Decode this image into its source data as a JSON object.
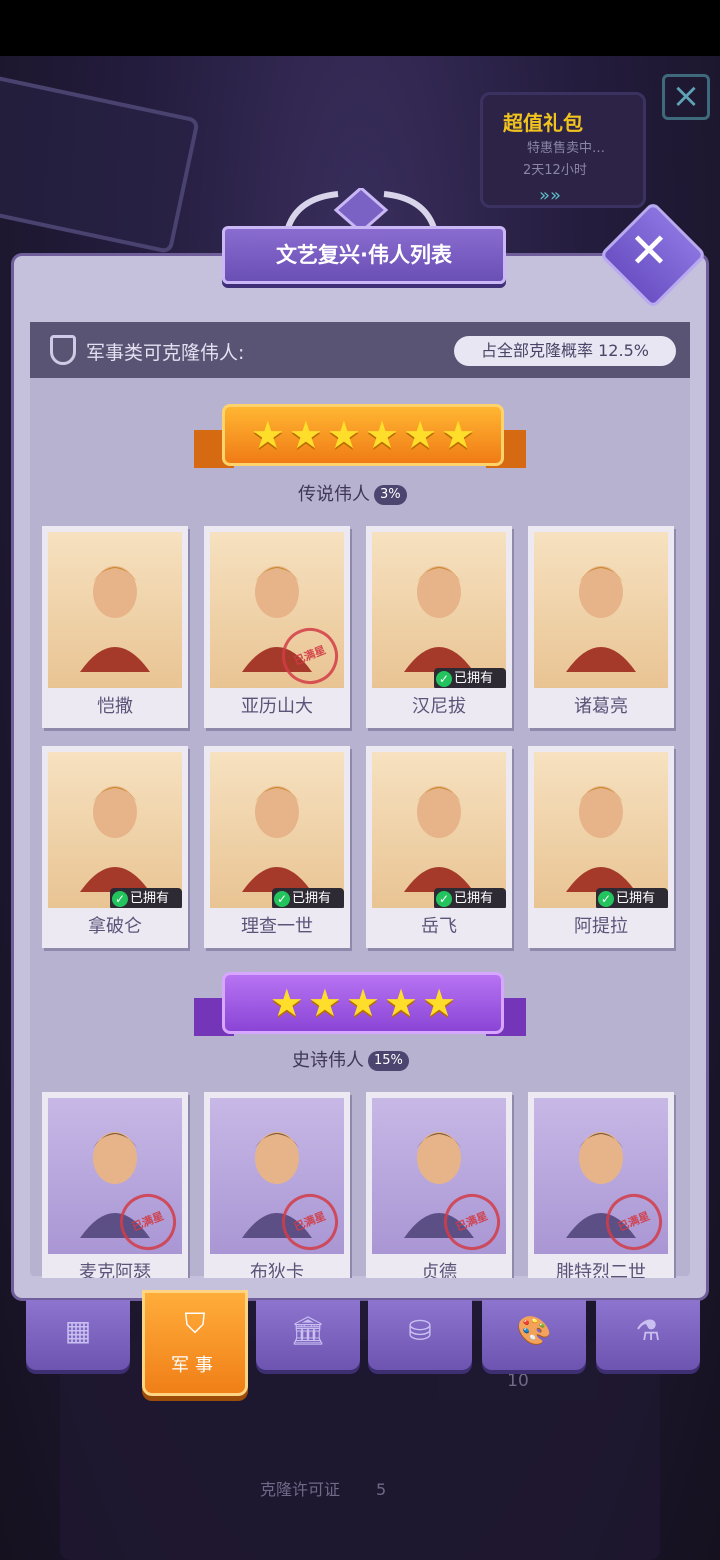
{
  "promo": {
    "title": "超值礼包",
    "subtitle": "特惠售卖中…",
    "timer": "2天12小时"
  },
  "panel": {
    "title": "文艺复兴·伟人列表",
    "category_label": "军事类可克隆伟人:",
    "clone_rate": "占全部克隆概率 12.5%"
  },
  "sections": [
    {
      "stars": 6,
      "name": "传说伟人",
      "percent": "3%",
      "cards": [
        {
          "name": "恺撒",
          "owned": false,
          "stamped": false
        },
        {
          "name": "亚历山大",
          "owned": false,
          "stamped": true
        },
        {
          "name": "汉尼拔",
          "owned": true,
          "stamped": false
        },
        {
          "name": "诸葛亮",
          "owned": false,
          "stamped": false
        },
        {
          "name": "拿破仑",
          "owned": true,
          "stamped": false
        },
        {
          "name": "理查一世",
          "owned": true,
          "stamped": false
        },
        {
          "name": "岳飞",
          "owned": true,
          "stamped": false
        },
        {
          "name": "阿提拉",
          "owned": true,
          "stamped": false
        }
      ]
    },
    {
      "stars": 5,
      "name": "史诗伟人",
      "percent": "15%",
      "cards": [
        {
          "name": "麦克阿瑟",
          "owned": false,
          "stamped": true
        },
        {
          "name": "布狄卡",
          "owned": false,
          "stamped": true
        },
        {
          "name": "贞德",
          "owned": false,
          "stamped": true
        },
        {
          "name": "腓特烈二世",
          "owned": false,
          "stamped": true
        }
      ]
    }
  ],
  "owned_label": "已拥有",
  "stamp_label": "已满星",
  "tabs": [
    {
      "icon": "grid-icon",
      "glyph": "▦",
      "label": "",
      "active": false
    },
    {
      "icon": "shield-icon",
      "glyph": "⛉",
      "label": "军事",
      "active": true
    },
    {
      "icon": "museum-icon",
      "glyph": "🏛",
      "label": "",
      "active": false
    },
    {
      "icon": "coins-icon",
      "glyph": "⛁",
      "label": "",
      "active": false
    },
    {
      "icon": "palette-icon",
      "glyph": "🎨",
      "label": "",
      "active": false
    },
    {
      "icon": "flask-icon",
      "glyph": "⚗",
      "label": "",
      "active": false
    }
  ],
  "footer": {
    "count": "10",
    "license_label": "克隆许可证",
    "license_count": "5"
  },
  "colors": {
    "legendary_ribbon": "#f07b16",
    "epic_ribbon": "#8a45d6",
    "owned_check": "#23c35d",
    "active_tab": "#f07f18"
  }
}
